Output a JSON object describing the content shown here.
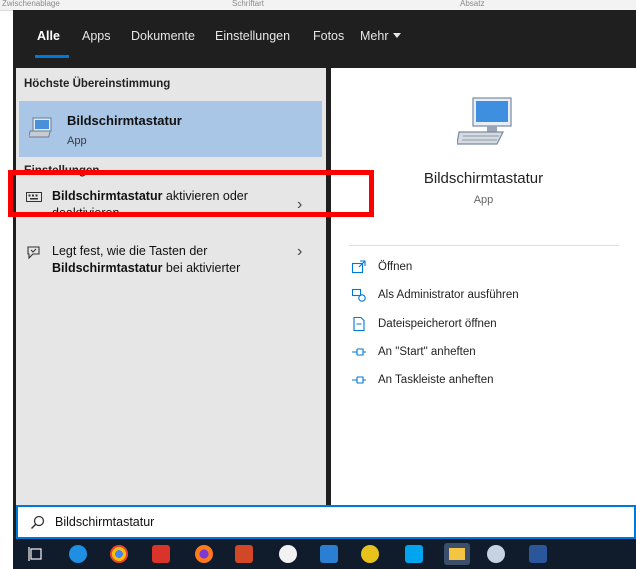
{
  "ribbon": {
    "groups": [
      "Zwischenablage",
      "Schriftart",
      "Absatz"
    ]
  },
  "tabs": [
    {
      "label": "Alle",
      "active": true
    },
    {
      "label": "Apps"
    },
    {
      "label": "Dokumente"
    },
    {
      "label": "Einstellungen"
    },
    {
      "label": "Fotos"
    },
    {
      "label": "Mehr"
    }
  ],
  "left": {
    "best_match_heading": "Höchste Übereinstimmung",
    "best_match": {
      "title": "Bildschirmtastatur",
      "subtitle": "App"
    },
    "settings_heading": "Einstellungen",
    "settings": [
      {
        "bold": "Bildschirmtastatur",
        "rest": " aktivieren oder deaktivieren"
      },
      {
        "prefix": "Legt fest, wie die Tasten der ",
        "bold": "Bildschirmtastatur",
        "rest": " bei aktivierter"
      }
    ]
  },
  "right": {
    "title": "Bildschirmtastatur",
    "subtitle": "App",
    "actions": [
      {
        "label": "Öffnen",
        "icon": "open-icon"
      },
      {
        "label": "Als Administrator ausführen",
        "icon": "admin-icon"
      },
      {
        "label": "Dateispeicherort öffnen",
        "icon": "file-location-icon"
      },
      {
        "label": "An \"Start\" anheften",
        "icon": "pin-icon"
      },
      {
        "label": "An Taskleiste anheften",
        "icon": "pin-icon"
      }
    ]
  },
  "search": {
    "value": "Bildschirmtastatur"
  },
  "colors": {
    "accent": "#0078d7",
    "selection": "#a9c6e6",
    "highlight_box": "#ff0000",
    "panel_dark": "#1f1f1f"
  },
  "taskbar": {
    "icons": [
      "task-view-icon",
      "edge-icon",
      "chrome-icon",
      "app-red-icon",
      "firefox-icon",
      "powerpoint-icon",
      "app-white-icon",
      "outlook-icon",
      "app-yellow-icon",
      "skype-icon",
      "file-explorer-icon",
      "paint-icon",
      "word-icon"
    ]
  }
}
